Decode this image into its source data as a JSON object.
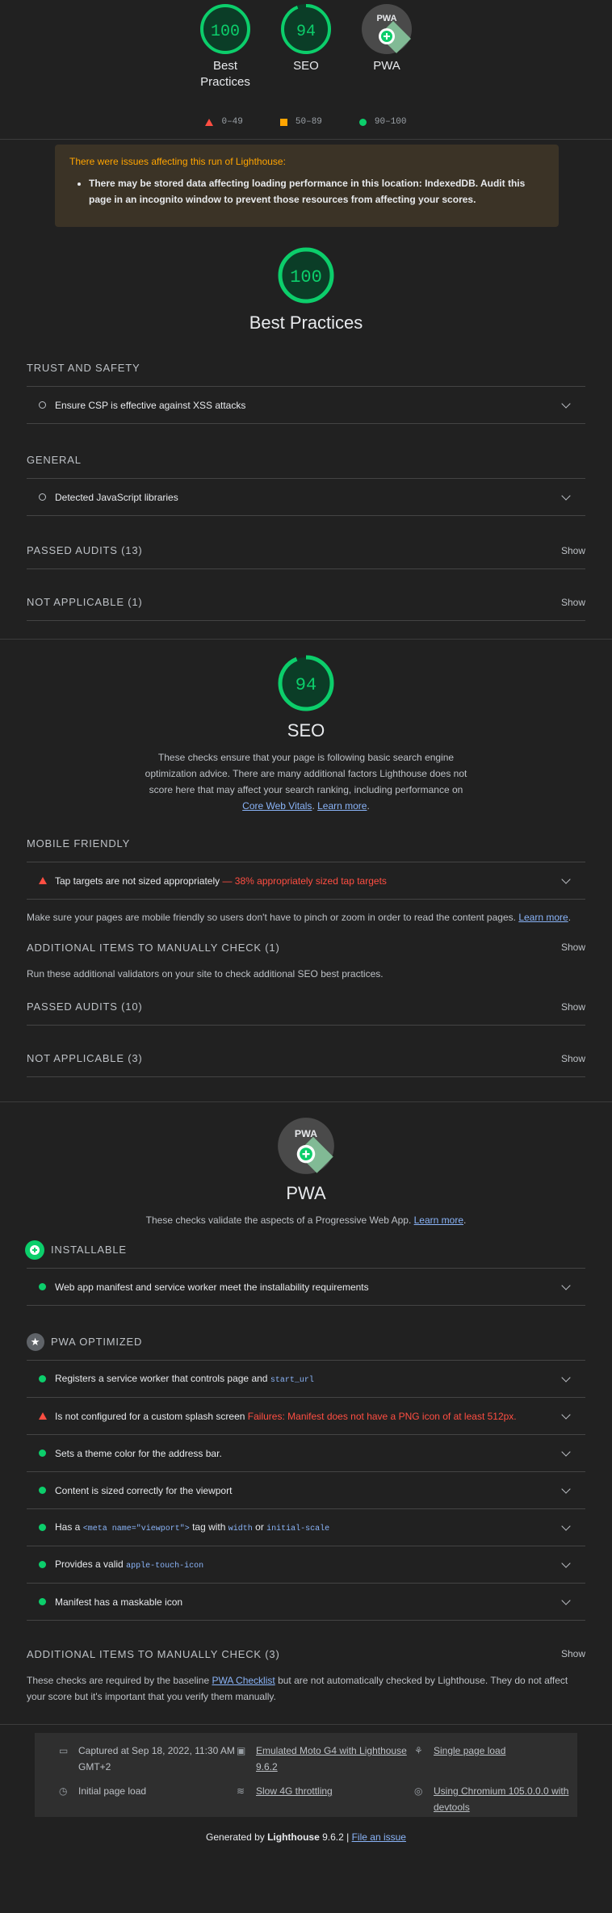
{
  "top_gauges": [
    {
      "score": "100",
      "label_line1": "Best",
      "label_line2": "Practices"
    },
    {
      "score": "94",
      "label_line1": "SEO",
      "label_line2": ""
    },
    {
      "score": "",
      "label_line1": "PWA",
      "label_line2": "",
      "pwa_badge": "PWA"
    }
  ],
  "legend": [
    {
      "icon": "triangle-icon",
      "label": "0–49"
    },
    {
      "icon": "square-icon",
      "label": "50–89"
    },
    {
      "icon": "circle-icon",
      "label": "90–100"
    }
  ],
  "warning": {
    "title": "There were issues affecting this run of Lighthouse:",
    "item": "There may be stored data affecting loading performance in this location: IndexedDB. Audit this page in an incognito window to prevent those resources from affecting your scores."
  },
  "best_practices": {
    "score": "100",
    "title": "Best Practices",
    "group_trust": "TRUST AND SAFETY",
    "audit_csp": "Ensure CSP is effective against XSS attacks",
    "group_general": "GENERAL",
    "audit_js": "Detected JavaScript libraries",
    "passed": "PASSED AUDITS (13)",
    "na": "NOT APPLICABLE (1)",
    "show": "Show"
  },
  "seo": {
    "score": "94",
    "title": "SEO",
    "desc_text": "These checks ensure that your page is following basic search engine optimization advice. There are many additional factors Lighthouse does not score here that may affect your search ranking, including performance on",
    "link_cwv": "Core Web Vitals",
    "link_learn": "Learn more",
    "group_mobile": "MOBILE FRIENDLY",
    "audit_tap": "Tap targets are not sized appropriately",
    "audit_tap_detail": "— 38% appropriately sized tap targets",
    "mobile_desc": "Make sure your pages are mobile friendly so users don't have to pinch or zoom in order to read the content pages.",
    "mobile_learn": "Learn more",
    "manual": "ADDITIONAL ITEMS TO MANUALLY CHECK (1)",
    "manual_desc": "Run these additional validators on your site to check additional SEO best practices.",
    "passed": "PASSED AUDITS (10)",
    "na": "NOT APPLICABLE (3)",
    "show": "Show"
  },
  "pwa": {
    "badge": "PWA",
    "title": "PWA",
    "desc": "These checks validate the aspects of a Progressive Web App.",
    "learn": "Learn more",
    "group_installable": "INSTALLABLE",
    "audit_manifest": "Web app manifest and service worker meet the installability requirements",
    "group_optimized": "PWA OPTIMIZED",
    "audit_sw": "Registers a service worker that controls page and",
    "audit_sw_code": "start_url",
    "audit_splash": "Is not configured for a custom splash screen",
    "audit_splash_detail": "Failures: Manifest does not have a PNG icon of at least 512px.",
    "audit_theme": "Sets a theme color for the address bar.",
    "audit_viewport_sized": "Content is sized correctly for the viewport",
    "audit_meta_pre": "Has a",
    "audit_meta_code": "<meta name=\"viewport\">",
    "audit_meta_mid": "tag with",
    "audit_meta_code2": "width",
    "audit_meta_or": "or",
    "audit_meta_code3": "initial-scale",
    "audit_touch_pre": "Provides a valid",
    "audit_touch_code": "apple-touch-icon",
    "audit_maskable": "Manifest has a maskable icon",
    "manual": "ADDITIONAL ITEMS TO MANUALLY CHECK (3)",
    "show": "Show",
    "manual_desc_pre": "These checks are required by the baseline",
    "manual_link": "PWA Checklist",
    "manual_desc_post": "but are not automatically checked by Lighthouse. They do not affect your score but it's important that you verify them manually."
  },
  "footer": {
    "captured": "Captured at Sep 18, 2022, 11:30 AM GMT+2",
    "initial": "Initial page load",
    "emulated": "Emulated Moto G4 with Lighthouse 9.6.2",
    "throttling": "Slow 4G throttling",
    "single": "Single page load",
    "chromium": "Using Chromium 105.0.0.0 with devtools",
    "generated_pre": "Generated by",
    "generated_brand": "Lighthouse",
    "generated_ver": "9.6.2 |",
    "file_issue": "File an issue"
  },
  "colors": {
    "pass": "#0cce6b",
    "fail": "#ff4e42",
    "average": "#ffa400",
    "background": "#212121"
  }
}
